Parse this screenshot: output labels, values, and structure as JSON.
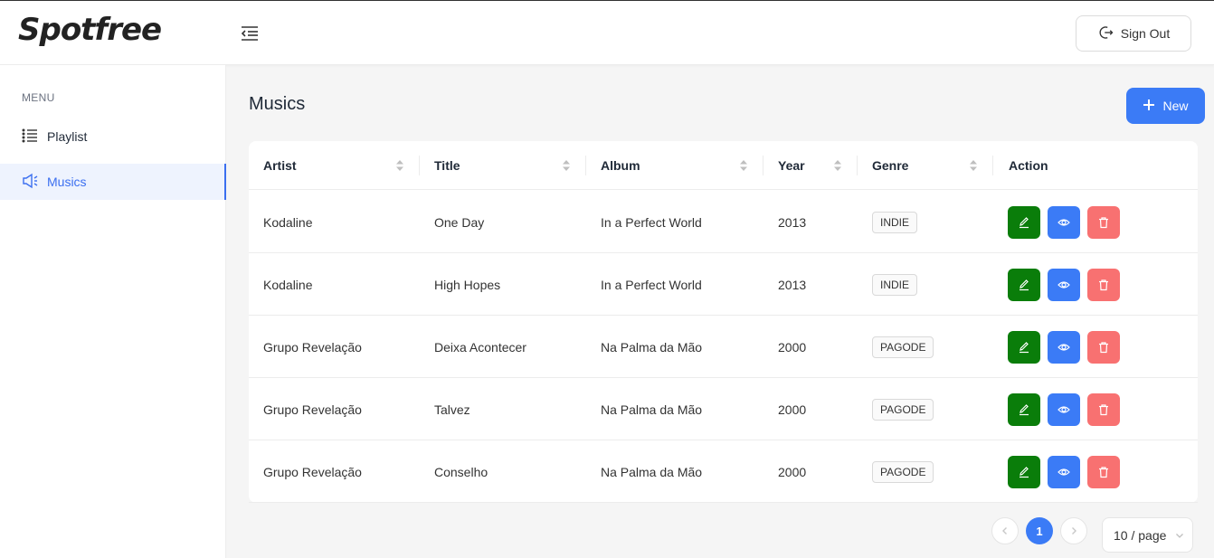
{
  "app": {
    "logo": "Spotfree",
    "signout_label": "Sign Out"
  },
  "sidebar": {
    "menu_label": "MENU",
    "items": [
      {
        "label": "Playlist",
        "icon": "list-icon",
        "active": false
      },
      {
        "label": "Musics",
        "icon": "sound-icon",
        "active": true
      }
    ]
  },
  "main": {
    "title": "Musics",
    "new_label": "New"
  },
  "table": {
    "columns": [
      "Artist",
      "Title",
      "Album",
      "Year",
      "Genre",
      "Action"
    ],
    "rows": [
      {
        "artist": "Kodaline",
        "title": "One Day",
        "album": "In a Perfect World",
        "year": "2013",
        "genre": "INDIE"
      },
      {
        "artist": "Kodaline",
        "title": "High Hopes",
        "album": "In a Perfect World",
        "year": "2013",
        "genre": "INDIE"
      },
      {
        "artist": "Grupo Revelação",
        "title": "Deixa Acontecer",
        "album": "Na Palma da Mão",
        "year": "2000",
        "genre": "PAGODE"
      },
      {
        "artist": "Grupo Revelação",
        "title": "Talvez",
        "album": "Na Palma da Mão",
        "year": "2000",
        "genre": "PAGODE"
      },
      {
        "artist": "Grupo Revelação",
        "title": "Conselho",
        "album": "Na Palma da Mão",
        "year": "2000",
        "genre": "PAGODE"
      }
    ]
  },
  "pagination": {
    "current_page": "1",
    "page_size": "10 / page"
  },
  "colors": {
    "primary": "#3b7bf6",
    "edit": "#0a7d0a",
    "view": "#3b7bf6",
    "delete": "#f87171",
    "active_bg": "#eef3fe"
  }
}
